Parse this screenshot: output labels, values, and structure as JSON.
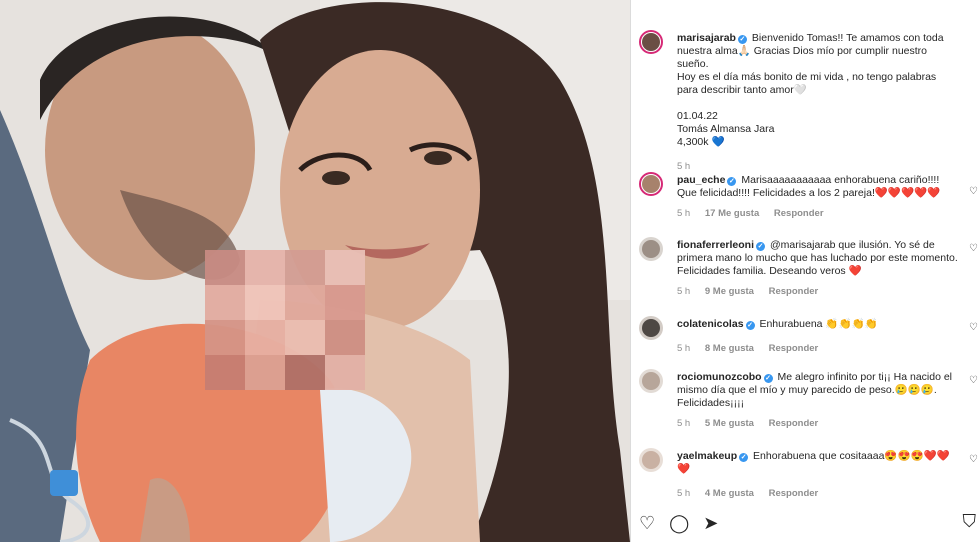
{
  "caption": {
    "username": "marisajarab",
    "text": "Bienvenido Tomas!! Te amamos con toda nuestra alma🙏🏻 Gracias Dios mío por cumplir nuestro sueño.\nHoy es el día más bonito de mi vida , no tengo palabras para describir tanto amor🤍\n\n01.04.22\nTomás Almansa Jara\n4,300k 💙",
    "time": "5 h"
  },
  "comments": [
    {
      "username": "pau_eche",
      "text": "Marisaaaaaaaaaaa enhorabuena cariño!!!! Que felicidad!!!! Felicidades a los 2 pareja!❤️❤️❤️❤️❤️",
      "time": "5 h",
      "likes": "17 Me gusta",
      "reply": "Responder"
    },
    {
      "username": "fionaferrerleoni",
      "text": "@marisajarab que ilusión. Yo sé de primera mano lo mucho que has luchado por este momento. Felicidades familia. Deseando veros ❤️",
      "time": "5 h",
      "likes": "9 Me gusta",
      "reply": "Responder"
    },
    {
      "username": "colatenicolas",
      "text": "Enhurabuena 👏👏👏👏",
      "time": "5 h",
      "likes": "8 Me gusta",
      "reply": "Responder"
    },
    {
      "username": "rociomunozcobo",
      "text": "Me alegro infinito por ti¡¡ Ha nacido el mismo día que el mío y muy parecido de peso.🥲🥲🥲. Felicidades¡¡¡¡",
      "time": "5 h",
      "likes": "5 Me gusta",
      "reply": "Responder"
    },
    {
      "username": "yaelmakeup",
      "text": "Enhorabuena que cositaaaa😍😍😍❤️❤️❤️",
      "time": "5 h",
      "likes": "4 Me gusta",
      "reply": "Responder"
    }
  ],
  "icons": {
    "like": "heart-icon",
    "comment": "comment-icon",
    "share": "share-icon",
    "save": "bookmark-icon",
    "verified": "verified-badge-icon"
  },
  "glyphs": {
    "heart": "♡",
    "comment": "◯",
    "share": "➤",
    "save": "⛉",
    "verified": "✓"
  },
  "colors": {
    "verified": "#3897f0",
    "story_ring": "#d62976",
    "meta_text": "#8e8e8e"
  }
}
